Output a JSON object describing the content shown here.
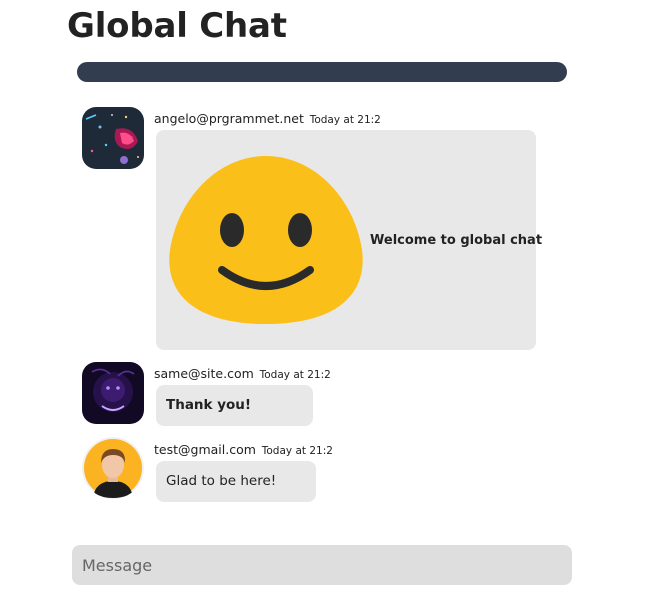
{
  "page": {
    "title": "Global Chat"
  },
  "messages": [
    {
      "user": "angelo@prgrammet.net",
      "time": "Today at 21:2",
      "text": "Welcome to global chat",
      "has_image": true,
      "image_icon": "smiley-face-icon",
      "avatar_icon": "space-galaxy-avatar-icon"
    },
    {
      "user": "same@site.com",
      "time": "Today at 21:2",
      "text": "Thank you!",
      "avatar_icon": "dark-purple-avatar-icon"
    },
    {
      "user": "test@gmail.com",
      "time": "Today at 21:2",
      "text": "Glad to be here!",
      "avatar_icon": "person-avatar-icon"
    }
  ],
  "composer": {
    "placeholder": "Message",
    "value": ""
  },
  "colors": {
    "topbar": "#323d50",
    "bubble": "#e8e8e8",
    "composer": "#dedede",
    "smiley": "#fbbf1a"
  }
}
